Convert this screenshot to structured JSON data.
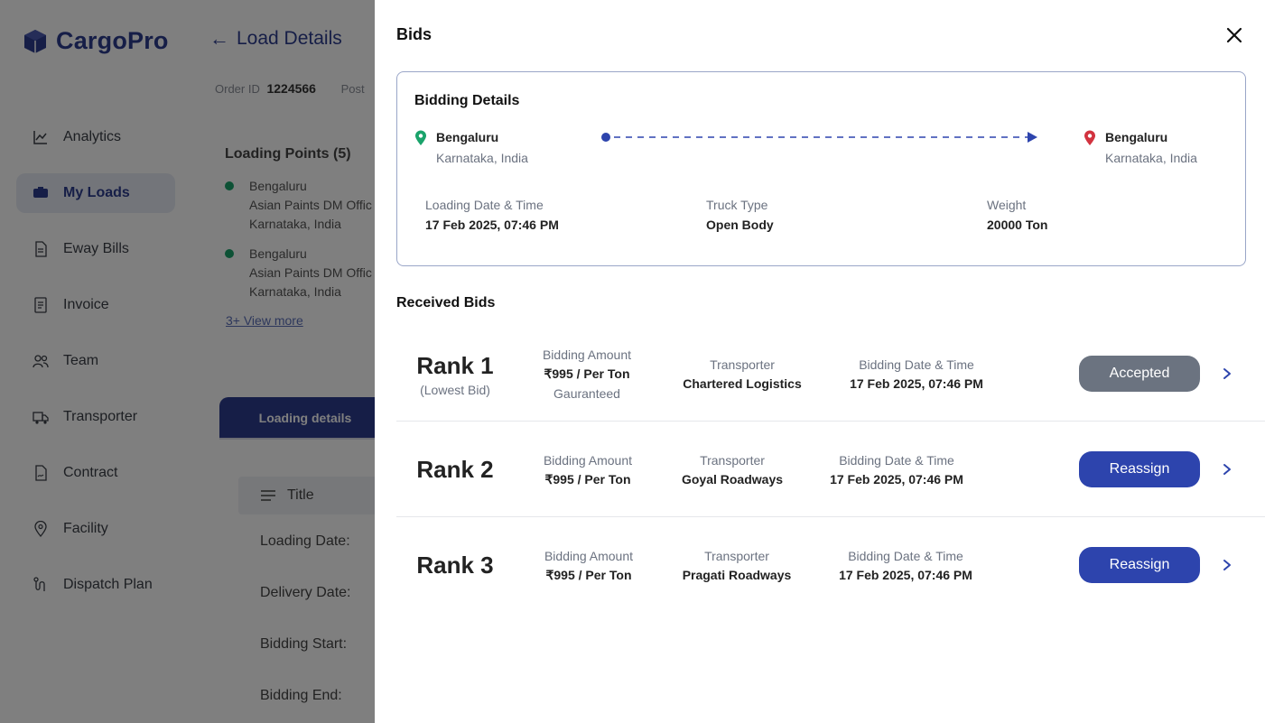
{
  "app": {
    "brand": "CargoPro",
    "page_title": "Load Details",
    "order_label": "Order ID",
    "order_id": "1224566",
    "posted_partial": "Post",
    "nav": [
      {
        "label": "Analytics",
        "icon": "chart-icon"
      },
      {
        "label": "My Loads",
        "icon": "truck-box-icon",
        "active": true
      },
      {
        "label": "Eway Bills",
        "icon": "document-icon"
      },
      {
        "label": "Invoice",
        "icon": "invoice-icon"
      },
      {
        "label": "Team",
        "icon": "team-icon"
      },
      {
        "label": "Transporter",
        "icon": "truck-icon"
      },
      {
        "label": "Contract",
        "icon": "contract-icon"
      },
      {
        "label": "Facility",
        "icon": "location-icon"
      },
      {
        "label": "Dispatch Plan",
        "icon": "route-icon"
      }
    ],
    "loading_points_title": "Loading Points (5)",
    "loading_points": [
      {
        "city": "Bengaluru",
        "address": "Asian Paints DM Offic",
        "state": "Karnataka, India"
      },
      {
        "city": "Bengaluru",
        "address": "Asian Paints DM Offic",
        "state": "Karnataka, India"
      }
    ],
    "view_more": "3+ View more",
    "tab_loading": "Loading details",
    "title_col": "Title",
    "fields": [
      "Loading Date:",
      "Delivery Date:",
      "Bidding Start:",
      "Bidding End:"
    ]
  },
  "drawer": {
    "title": "Bids",
    "details": {
      "title": "Bidding Details",
      "origin": {
        "city": "Bengaluru",
        "state": "Karnataka, India"
      },
      "destination": {
        "city": "Bengaluru",
        "state": "Karnataka, India"
      },
      "loading_label": "Loading Date & Time",
      "loading_value": "17 Feb 2025, 07:46 PM",
      "truck_label": "Truck Type",
      "truck_value": "Open Body",
      "weight_label": "Weight",
      "weight_value": "20000 Ton"
    },
    "received_title": "Received Bids",
    "bids": [
      {
        "rank": "Rank 1",
        "rank_sub": "(Lowest Bid)",
        "amount_label": "Bidding Amount",
        "amount": "₹995 / Per Ton",
        "amount_note": "Gauranteed",
        "transporter_label": "Transporter",
        "transporter": "Chartered  Logistics",
        "date_label": "Bidding Date & Time",
        "date": "17 Feb 2025, 07:46 PM",
        "status": "Accepted"
      },
      {
        "rank": "Rank 2",
        "amount_label": "Bidding Amount",
        "amount": "₹995 / Per Ton",
        "transporter_label": "Transporter",
        "transporter": "Goyal Roadways",
        "date_label": "Bidding Date & Time",
        "date": "17 Feb 2025, 07:46 PM",
        "status": "Reassign"
      },
      {
        "rank": "Rank 3",
        "amount_label": "Bidding Amount",
        "amount": "₹995 / Per Ton",
        "transporter_label": "Transporter",
        "transporter": "Pragati Roadways",
        "date_label": "Bidding Date & Time",
        "date": "17 Feb 2025, 07:46 PM",
        "status": "Reassign"
      }
    ]
  },
  "colors": {
    "brand": "#2d3c8f",
    "accepted": "#6b7380",
    "reassign": "#2d44ad",
    "origin_pin": "#1aa36b",
    "destination_pin": "#d2333f"
  }
}
